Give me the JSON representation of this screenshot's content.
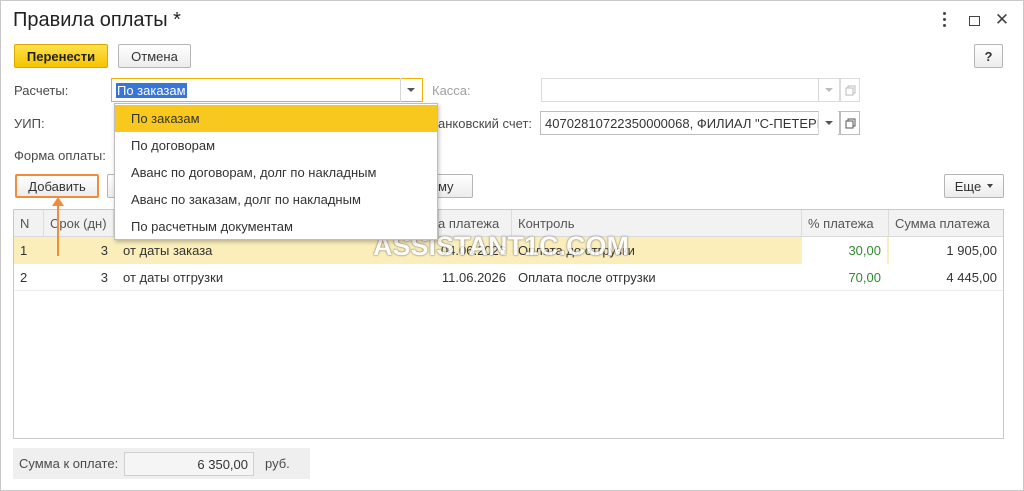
{
  "window": {
    "title": "Правила оплаты *",
    "close_glyph": "✕"
  },
  "toolbar": {
    "transfer_label": "Перенести",
    "cancel_label": "Отмена",
    "help_label": "?"
  },
  "form": {
    "payments_label": "Расчеты:",
    "payments_value": "По заказам",
    "cash_label": "Касса:",
    "cash_value": "",
    "uip_label": "УИП:",
    "bank_account_label": "анковский счет:",
    "bank_account_value": "40702810722350000068, ФИЛИАЛ \"С-ПЕТЕРІ",
    "payment_form_label": "Форма оплаты:"
  },
  "table_toolbar": {
    "add_label": "Добавить",
    "partial_button_label": "мму",
    "more_label": "Еще"
  },
  "dropdown": {
    "items": [
      "По заказам",
      "По договорам",
      "Аванс по договорам, долг по накладным",
      "Аванс по заказам, долг по накладным",
      "По расчетным документам"
    ],
    "selected_index": 0
  },
  "table": {
    "columns": [
      "N",
      "Срок (дн)",
      "",
      "а платежа",
      "Контроль",
      "% платежа",
      "Сумма платежа"
    ],
    "rows": [
      {
        "n": "1",
        "term": "3",
        "basis": "от даты заказа",
        "date": "04.06.2026",
        "control": "Оплата до отгрузки",
        "percent": "30,00",
        "amount": "1 905,00"
      },
      {
        "n": "2",
        "term": "3",
        "basis": "от даты отгрузки",
        "date": "11.06.2026",
        "control": "Оплата после отгрузки",
        "percent": "70,00",
        "amount": "4 445,00"
      }
    ],
    "selected_row": 0
  },
  "footer": {
    "total_label": "Сумма к оплате:",
    "total_value": "6 350,00",
    "currency": "руб."
  },
  "watermark": "ASSISTANT1C.COM",
  "colors": {
    "accent_yellow": "#f5c400",
    "selected_row": "#fbeebb",
    "highlight_item": "#f9c81e",
    "percent_green": "#2e8b2e",
    "annotation_arrow": "#f08c3c"
  },
  "icons": [
    "more-vertical-icon",
    "maximize-icon",
    "close-icon",
    "dropdown-arrow-icon",
    "open-icon"
  ]
}
